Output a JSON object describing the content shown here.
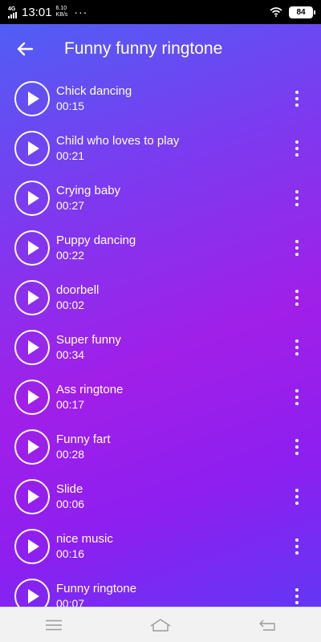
{
  "status_bar": {
    "network": "4G",
    "time": "13:01",
    "speed_value": "6.10",
    "speed_unit": "KB/s",
    "more": "···",
    "battery": "84",
    "icons": [
      "signal-icon",
      "wifi-icon",
      "battery-icon"
    ]
  },
  "app_bar": {
    "back_icon": "arrow-left-icon",
    "title": "Funny funny ringtone"
  },
  "ringtones": [
    {
      "title": "Chick dancing",
      "duration": "00:15"
    },
    {
      "title": "Child who loves to play",
      "duration": "00:21"
    },
    {
      "title": "Crying baby",
      "duration": "00:27"
    },
    {
      "title": "Puppy dancing",
      "duration": "00:22"
    },
    {
      "title": "doorbell",
      "duration": "00:02"
    },
    {
      "title": "Super funny",
      "duration": "00:34"
    },
    {
      "title": "Ass ringtone",
      "duration": "00:17"
    },
    {
      "title": "Funny fart",
      "duration": "00:28"
    },
    {
      "title": "Slide",
      "duration": "00:06"
    },
    {
      "title": "nice music",
      "duration": "00:16"
    },
    {
      "title": "Funny ringtone",
      "duration": "00:07"
    }
  ],
  "item_icons": {
    "play": "play-icon",
    "more": "more-vertical-icon"
  },
  "nav_bar": {
    "icons": [
      "menu-icon",
      "home-icon",
      "back-icon"
    ]
  },
  "colors": {
    "gradient_start": "#4a63f5",
    "gradient_mid": "#a11fe8",
    "gradient_end": "#5a3cf6",
    "text": "#ffffff",
    "nav_bg": "#f2f2f2"
  }
}
